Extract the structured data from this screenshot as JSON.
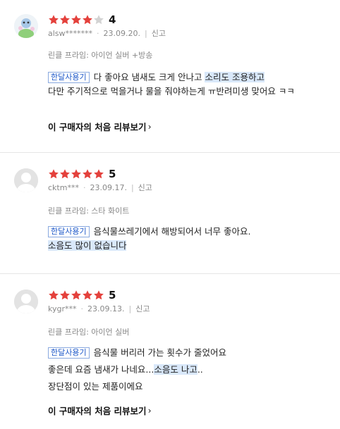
{
  "reviews": [
    {
      "rating": 4,
      "score_label": "4",
      "user": "alsw*******",
      "date": "23.09.20.",
      "report": "신고",
      "option": "린클 프라임: 아이언 실버 +방송",
      "tag": "한달사용기",
      "lines": [
        {
          "plain": "다 좋아요 냄새도 크게 안나고 ",
          "hl": "소리도 조용하고",
          "tail": ""
        },
        {
          "plain": "다만 주기적으로 먹을거나 물을 줘야하는게 ㅠ반려미생 맞어요 ㅋㅋ",
          "hl": "",
          "tail": ""
        }
      ],
      "first_review_label": "이 구매자의 처음 리뷰보기"
    },
    {
      "rating": 5,
      "score_label": "5",
      "user": "cktm***",
      "date": "23.09.17.",
      "report": "신고",
      "option": "린클 프라임: 스타 화이트",
      "tag": "한달사용기",
      "lines": [
        {
          "plain": "음식물쓰레기에서 해방되어서 너무 좋아요.",
          "hl": "",
          "tail": ""
        },
        {
          "plain": "",
          "hl": "소음도 많이 없습니다",
          "tail": ""
        }
      ],
      "first_review_label": ""
    },
    {
      "rating": 5,
      "score_label": "5",
      "user": "kygr***",
      "date": "23.09.13.",
      "report": "신고",
      "option": "린클 프라임: 아이언 실버",
      "tag": "한달사용기",
      "lines": [
        {
          "plain": "음식물 버리러 가는 횟수가 줄었어요",
          "hl": "",
          "tail": ""
        },
        {
          "plain": "좋은데 요즘 냄새가 나네요...",
          "hl": "소음도 나고",
          "tail": ".."
        },
        {
          "plain": "장단점이 있는 제품이에요",
          "hl": "",
          "tail": ""
        }
      ],
      "first_review_label": "이 구매자의 처음 리뷰보기"
    }
  ],
  "colors": {
    "star_on": "#e4413c",
    "star_off": "#d3d3d3",
    "highlight": "#d9e8fa",
    "tag": "#1d58c9"
  }
}
